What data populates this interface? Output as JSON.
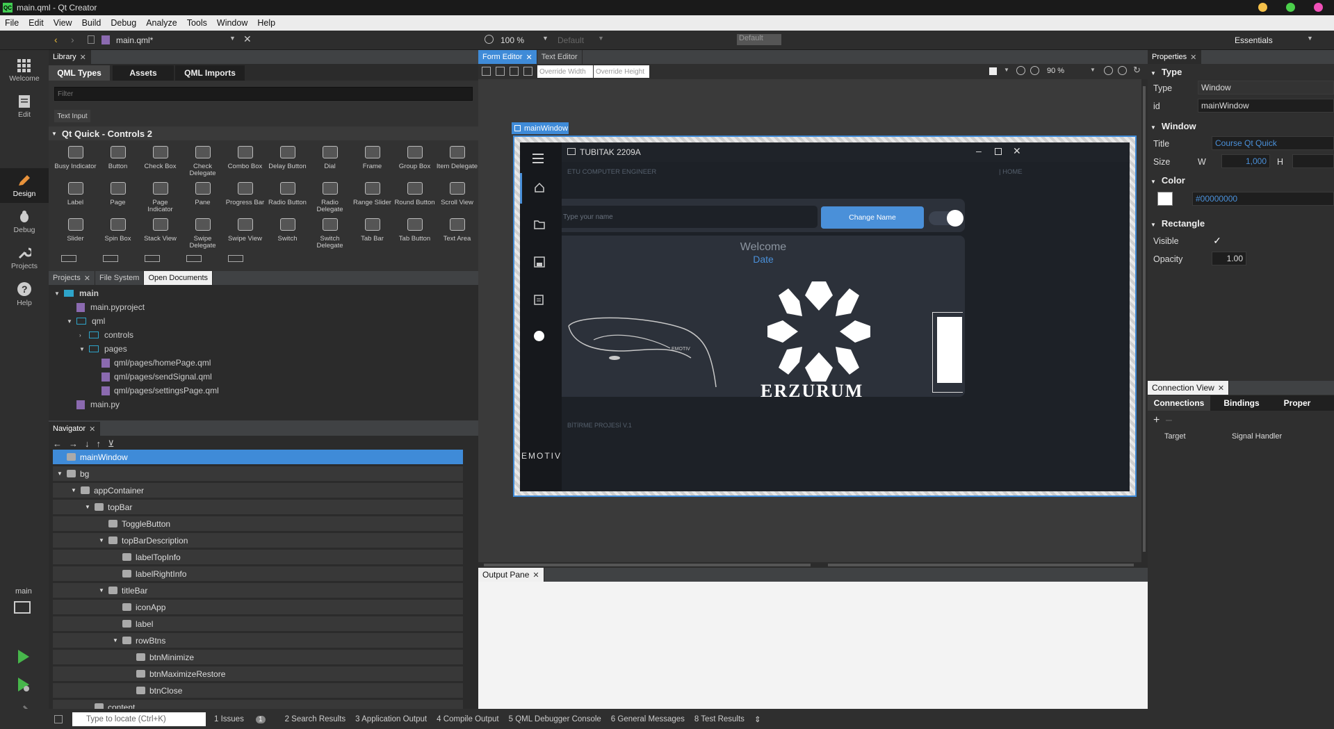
{
  "window": {
    "title": "main.qml - Qt Creator",
    "logo": "QC"
  },
  "menu": [
    "File",
    "Edit",
    "View",
    "Build",
    "Debug",
    "Analyze",
    "Tools",
    "Window",
    "Help"
  ],
  "toolbar": {
    "file": "main.qml*",
    "zoom": "100 %",
    "device": "Default",
    "style": "Default",
    "workspace": "Essentials"
  },
  "modes": [
    {
      "label": "Welcome",
      "icon": "grid-icon"
    },
    {
      "label": "Edit",
      "icon": "document-icon"
    },
    {
      "label": "Design",
      "icon": "pencil-icon"
    },
    {
      "label": "Debug",
      "icon": "bug-icon"
    },
    {
      "label": "Projects",
      "icon": "wrench-icon"
    },
    {
      "label": "Help",
      "icon": "help-icon"
    }
  ],
  "kit": {
    "label": "main"
  },
  "library": {
    "title": "Library",
    "tabs": [
      "QML Types",
      "Assets",
      "QML Imports"
    ],
    "filter_placeholder": "Filter",
    "chip": "Text Input",
    "section": "Qt Quick - Controls 2",
    "items": [
      "Busy Indicator",
      "Button",
      "Check Box",
      "Check Delegate",
      "Combo Box",
      "Delay Button",
      "Dial",
      "Frame",
      "Group Box",
      "Item Delegate",
      "Label",
      "Page",
      "Page Indicator",
      "Pane",
      "Progress Bar",
      "Radio Button",
      "Radio Delegate",
      "Range Slider",
      "Round Button",
      "Scroll View",
      "Slider",
      "Spin Box",
      "Stack View",
      "Swipe Delegate",
      "Swipe View",
      "Switch",
      "Switch Delegate",
      "Tab Bar",
      "Tab Button",
      "Text Area"
    ]
  },
  "projects": {
    "tabs": [
      "Projects",
      "File System",
      "Open Documents"
    ],
    "tree": [
      "main",
      "main.pyproject",
      "qml",
      "controls",
      "pages",
      "qml/pages/homePage.qml",
      "qml/pages/sendSignal.qml",
      "qml/pages/settingsPage.qml",
      "main.py"
    ]
  },
  "navigator": {
    "title": "Navigator",
    "items": [
      "mainWindow",
      "bg",
      "appContainer",
      "topBar",
      "ToggleButton",
      "topBarDescription",
      "labelTopInfo",
      "labelRightInfo",
      "titleBar",
      "iconApp",
      "label",
      "rowBtns",
      "btnMinimize",
      "btnMaximizeRestore",
      "btnClose",
      "content"
    ]
  },
  "editor": {
    "tabs": [
      "Form Editor",
      "Text Editor"
    ],
    "override_width": "Override Width",
    "override_height": "Override Height",
    "zoom": "90 %",
    "root_label": "mainWindow",
    "output_pane": "Output Pane"
  },
  "app": {
    "title": "TUBITAK 2209A",
    "top_info": "ETU COMPUTER ENGINEER",
    "right_info": "| HOME",
    "placeholder": "Type your name",
    "button": "Change Name",
    "welcome": "Welcome",
    "date": "Date",
    "brand": "EMOTIV",
    "bottom": "BİTİRME PROJESİ V.1",
    "headset_text": "EMOTIV",
    "logo_text": "ERZURUM"
  },
  "properties": {
    "title": "Properties",
    "type_section": "Type",
    "type_label": "Type",
    "type_value": "Window",
    "id_label": "id",
    "id_value": "mainWindow",
    "window_section": "Window",
    "title_label": "Title",
    "title_value": "Course Qt Quick",
    "size_label": "Size",
    "w_label": "W",
    "w_value": "1,000",
    "h_label": "H",
    "color_section": "Color",
    "color_value": "#00000000",
    "rect_section": "Rectangle",
    "visible_label": "Visible",
    "opacity_label": "Opacity",
    "opacity_value": "1.00"
  },
  "connection_view": {
    "title": "Connection View",
    "tabs": [
      "Connections",
      "Bindings",
      "Proper"
    ],
    "col_target": "Target",
    "col_handler": "Signal Handler"
  },
  "status": {
    "locate": "Type to locate (Ctrl+K)",
    "panes": [
      "1  Issues",
      "2  Search Results",
      "3  Application Output",
      "4  Compile Output",
      "5  QML Debugger Console",
      "6  General Messages",
      "8  Test Results"
    ],
    "issues_count": "1"
  },
  "colors": {
    "accent": "#4a90d9",
    "selection": "#3f8bd8",
    "app_bg": "#1d2127"
  }
}
